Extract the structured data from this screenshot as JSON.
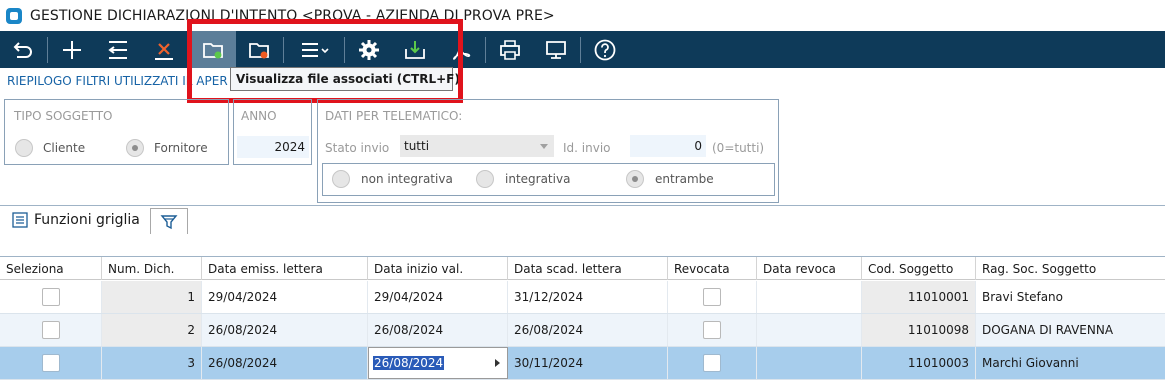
{
  "window": {
    "title": "GESTIONE DICHIARAZIONI D'INTENTO <PROVA - AZIENDA DI PROVA PRE>"
  },
  "toolbar": {
    "buttons": [
      {
        "icon": "back-arrow-icon"
      },
      {
        "icon": "plus-icon"
      },
      {
        "icon": "undo-list-icon"
      },
      {
        "icon": "delete-x-icon"
      },
      {
        "icon": "folder-green-icon",
        "active": true
      },
      {
        "icon": "folder-orange-icon"
      },
      {
        "icon": "menu-dropdown-icon"
      },
      {
        "icon": "gear-icon"
      },
      {
        "icon": "download-tray-icon"
      },
      {
        "icon": "pdf-icon"
      },
      {
        "icon": "printer-icon"
      },
      {
        "icon": "monitor-icon"
      },
      {
        "icon": "help-icon"
      }
    ],
    "tooltip": "Visualizza file associati (CTRL+F)"
  },
  "filters_summary": "RIEPILOGO FILTRI UTILIZZATI IL APER",
  "filters": {
    "tipo_soggetto": {
      "title": "TIPO SOGGETTO",
      "options": [
        "Cliente",
        "Fornitore"
      ],
      "selected": "Fornitore"
    },
    "anno": {
      "title": "ANNO",
      "value": "2024"
    },
    "telematico": {
      "title": "DATI PER TELEMATICO:",
      "stato_invio_label": "Stato invio",
      "stato_invio_value": "tutti",
      "id_invio_label": "Id. invio",
      "id_invio_value": "0",
      "id_invio_hint": "(0=tutti)",
      "options": [
        "non integrativa",
        "integrativa",
        "entrambe"
      ],
      "selected": "entrambe"
    }
  },
  "grid_toolbar": {
    "funzioni_label": "Funzioni griglia"
  },
  "grid": {
    "columns": [
      "Seleziona",
      "Num. Dich.",
      "Data emiss. lettera",
      "Data inizio val.",
      "Data scad. lettera",
      "Revocata",
      "Data revoca",
      "Cod. Soggetto",
      "Rag. Soc. Soggetto"
    ],
    "rows": [
      {
        "num": "1",
        "emiss": "29/04/2024",
        "inizio": "29/04/2024",
        "scad": "31/12/2024",
        "revoca": "",
        "cod": "11010001",
        "ragsoc": "Bravi Stefano"
      },
      {
        "num": "2",
        "emiss": "26/08/2024",
        "inizio": "26/08/2024",
        "scad": "26/08/2024",
        "revoca": "",
        "cod": "11010098",
        "ragsoc": "DOGANA DI RAVENNA"
      },
      {
        "num": "3",
        "emiss": "26/08/2024",
        "inizio": "26/08/2024",
        "scad": "30/11/2024",
        "revoca": "",
        "cod": "11010003",
        "ragsoc": "Marchi Giovanni"
      }
    ]
  },
  "colors": {
    "toolbar_bg": "#0e3a59",
    "highlight": "#e0131c",
    "selected_row": "#a7cdec",
    "link_blue": "#1763a6"
  }
}
